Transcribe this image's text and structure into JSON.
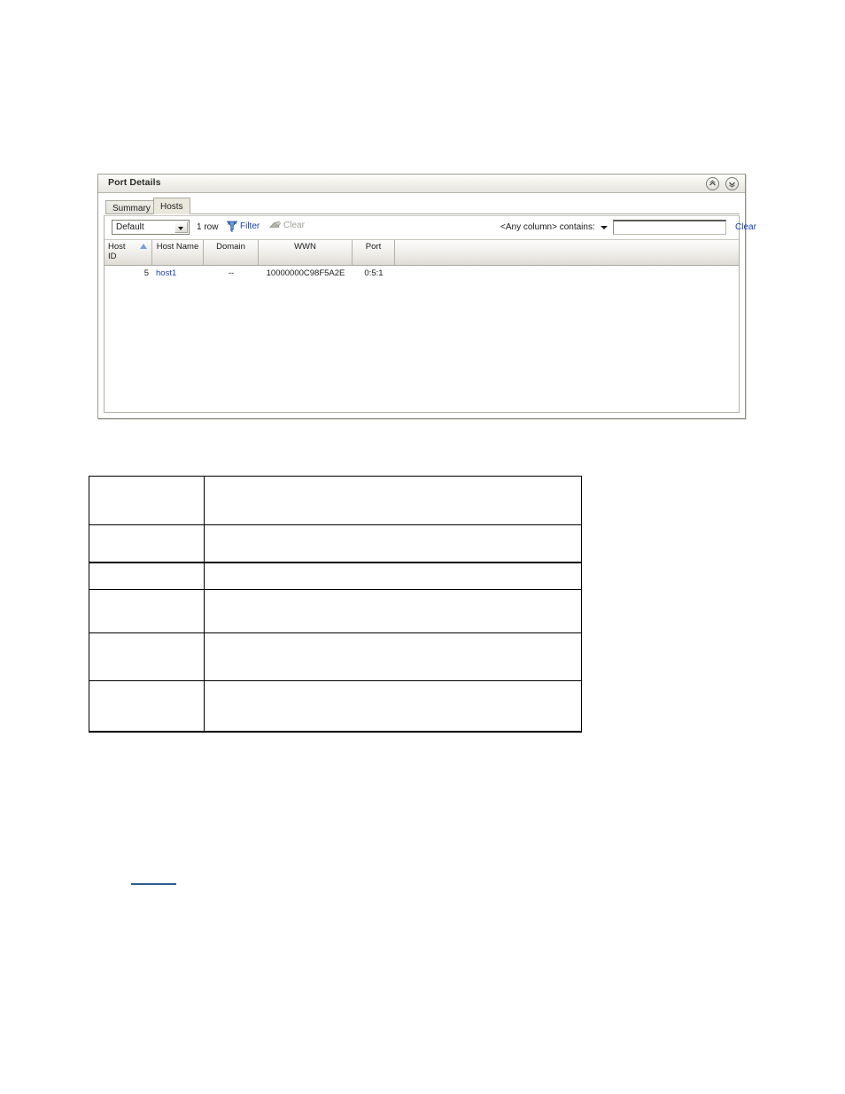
{
  "panel": {
    "title": "Port Details",
    "titlebar_buttons": [
      {
        "name": "collapse-button",
        "icon": "chevron-up-circle-icon"
      },
      {
        "name": "expand-button",
        "icon": "chevron-down-circle-icon"
      }
    ],
    "tabs": [
      {
        "label": "Summary",
        "active": false
      },
      {
        "label": "Hosts",
        "active": true
      }
    ],
    "toolbar": {
      "view_select_value": "Default",
      "row_count": "1 row",
      "filter_label": "Filter",
      "filter_icon": "funnel-icon",
      "clear_label": "Clear",
      "clear_icon": "eraser-icon",
      "clear_enabled": false,
      "quick_filter_label": "<Any column> contains:",
      "quick_filter_value": "",
      "quick_filter_placeholder": "",
      "quick_filter_clear_label": "Clear"
    },
    "grid": {
      "columns": [
        {
          "label": "Host ID",
          "line1": "Host",
          "line2": "ID",
          "sorted": true,
          "sort_direction": "ascending"
        },
        {
          "label": "Host Name",
          "line1": "Host Name",
          "line2": "",
          "sorted": false
        },
        {
          "label": "Domain",
          "line1": "Domain",
          "line2": "",
          "sorted": false
        },
        {
          "label": "WWN",
          "line1": "WWN",
          "line2": "",
          "sorted": false
        },
        {
          "label": "Port",
          "line1": "Port",
          "line2": "",
          "sorted": false
        }
      ],
      "rows": [
        {
          "host_id": "5",
          "host_name": "host1",
          "domain": "--",
          "wwn": "10000000C98F5A2E",
          "port": "0:5:1"
        }
      ]
    }
  },
  "document_table": {
    "rows": [
      {
        "col1": "",
        "col2": ""
      },
      {
        "col1": "",
        "col2": ""
      },
      {
        "col1": "",
        "col2": ""
      },
      {
        "col1": "",
        "col2": ""
      },
      {
        "col1": "",
        "col2": ""
      },
      {
        "col1": "",
        "col2": ""
      }
    ]
  },
  "footer": {
    "link_text": ""
  },
  "colors": {
    "link": "#1241ab",
    "cell_link": "#2040c0",
    "sort_triangle": "#7c9fd6",
    "disabled_text": "#9e9e98",
    "panel_border": "#9d9d95",
    "stray_link": "#2e5e91"
  }
}
